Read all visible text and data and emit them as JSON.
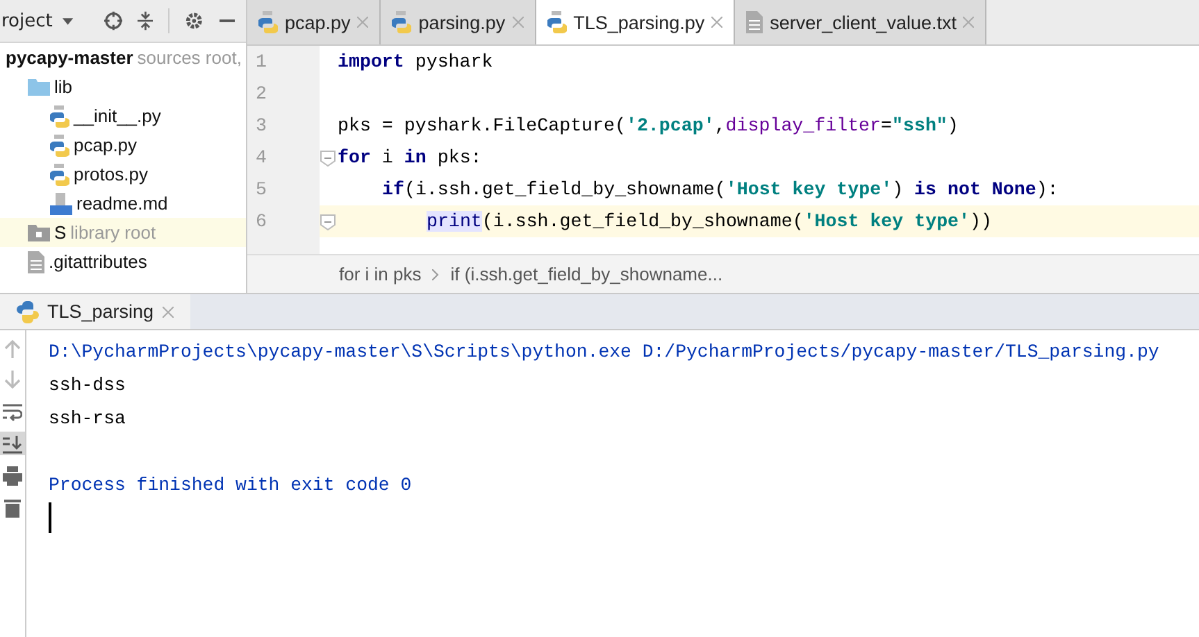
{
  "project_panel": {
    "title": "roject",
    "tree": [
      {
        "name": "pycapy-master",
        "note": "sources root,",
        "bold": true,
        "selected": false,
        "children": [
          {
            "name": "lib",
            "kind": "folder",
            "bold": false,
            "selected": false,
            "children": [
              {
                "name": "__init__.py",
                "kind": "python",
                "bold": false,
                "selected": false
              },
              {
                "name": "pcap.py",
                "kind": "python",
                "bold": false,
                "selected": false
              },
              {
                "name": "protos.py",
                "kind": "python",
                "bold": false,
                "selected": false
              },
              {
                "name": "readme.md",
                "kind": "markdown",
                "bold": false,
                "selected": false
              }
            ]
          },
          {
            "name": "S",
            "note": "library root",
            "kind": "library",
            "bold": false,
            "selected": true
          },
          {
            "name": ".gitattributes",
            "kind": "text",
            "bold": false,
            "selected": false
          }
        ]
      }
    ]
  },
  "tabs": [
    {
      "label": "pcap.py",
      "kind": "python",
      "selected": false
    },
    {
      "label": "parsing.py",
      "kind": "python",
      "selected": false
    },
    {
      "label": "TLS_parsing.py",
      "kind": "python",
      "selected": true
    },
    {
      "label": "server_client_value.txt",
      "kind": "text",
      "selected": false
    }
  ],
  "editor": {
    "lines": [
      {
        "number": "1",
        "current": false,
        "fold": false,
        "tokens": [
          {
            "t": "import",
            "kind": "keyword"
          },
          {
            "t": " pyshark",
            "kind": "plain"
          }
        ]
      },
      {
        "number": "2",
        "current": false,
        "fold": false
      },
      {
        "number": "3",
        "current": false,
        "fold": false,
        "tokens": [
          {
            "t": "pks = pyshark.FileCapture(",
            "kind": "plain"
          },
          {
            "t": "'2.pcap'",
            "kind": "string"
          },
          {
            "t": ",",
            "kind": "plain"
          },
          {
            "t": "display_filter",
            "kind": "param"
          },
          {
            "t": "=",
            "kind": "plain"
          },
          {
            "t": "\"ssh\"",
            "kind": "string"
          },
          {
            "t": ")",
            "kind": "plain"
          }
        ]
      },
      {
        "number": "4",
        "current": false,
        "fold": true,
        "tokens": [
          {
            "t": "for",
            "kind": "keyword"
          },
          {
            "t": " i ",
            "kind": "plain"
          },
          {
            "t": "in",
            "kind": "keyword"
          },
          {
            "t": " pks:",
            "kind": "plain"
          }
        ],
        "children": [
          {
            "number": "5",
            "current": false,
            "fold": false,
            "tokens": [
              {
                "t": "if",
                "kind": "keyword"
              },
              {
                "t": "(i.ssh.get_field_by_showname(",
                "kind": "plain"
              },
              {
                "t": "'Host key type'",
                "kind": "string"
              },
              {
                "t": ") ",
                "kind": "plain"
              },
              {
                "t": "is not None",
                "kind": "keyword"
              },
              {
                "t": "):",
                "kind": "plain"
              }
            ],
            "children": [
              {
                "number": "6",
                "current": true,
                "fold": true,
                "tokens": [
                  {
                    "t": "print",
                    "kind": "builtin"
                  },
                  {
                    "t": "(i.ssh.get_field_by_showname(",
                    "kind": "plain"
                  },
                  {
                    "t": "'Host key type'",
                    "kind": "string"
                  },
                  {
                    "t": "))",
                    "kind": "plain"
                  }
                ]
              }
            ]
          }
        ]
      }
    ],
    "breadcrumbs": [
      "for i in pks",
      "if (i.ssh.get_field_by_showname..."
    ]
  },
  "run_panel": {
    "tab": "TLS_parsing",
    "tools": [
      {
        "kind": "up",
        "selected": false
      },
      {
        "kind": "down",
        "selected": false
      },
      {
        "kind": "wrap",
        "selected": false
      },
      {
        "kind": "scroll",
        "selected": true
      },
      {
        "kind": "print",
        "selected": false
      },
      {
        "kind": "trash",
        "selected": false
      }
    ],
    "output": [
      {
        "text": "D:\\PycharmProjects\\pycapy-master\\S\\Scripts\\python.exe D:/PycharmProjects/pycapy-master/TLS_parsing.py",
        "kind": "system"
      },
      {
        "text": "ssh-dss",
        "kind": "stdout"
      },
      {
        "text": "ssh-rsa",
        "kind": "stdout"
      },
      {
        "kind": "blank"
      },
      {
        "text": "Process finished with exit code 0",
        "kind": "system"
      }
    ]
  }
}
